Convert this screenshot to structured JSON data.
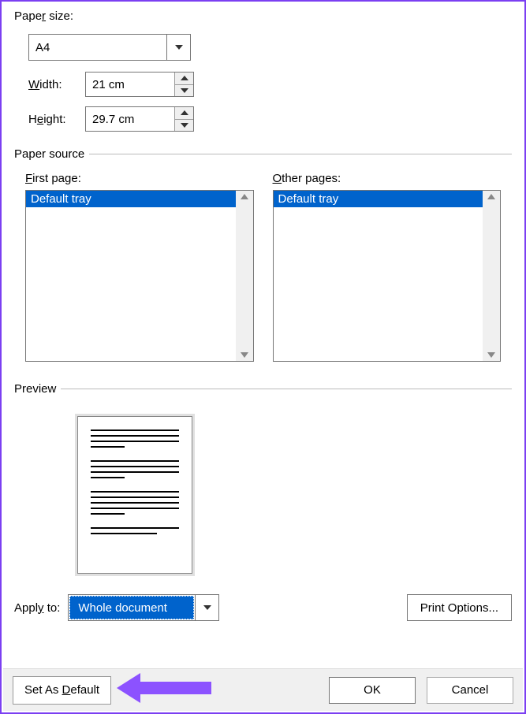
{
  "paper_size": {
    "label_pre": "Pape",
    "label_u": "r",
    "label_post": " size:",
    "selected": "A4",
    "width_label_u": "W",
    "width_label_post": "idth:",
    "width_value": "21 cm",
    "height_label_pre": "H",
    "height_label_u": "e",
    "height_label_post": "ight:",
    "height_value": "29.7 cm"
  },
  "paper_source": {
    "legend": "Paper source",
    "first_page_label_u": "F",
    "first_page_label_post": "irst page:",
    "first_page_selected": "Default tray",
    "other_pages_label_u": "O",
    "other_pages_label_post": "ther pages:",
    "other_pages_selected": "Default tray"
  },
  "preview": {
    "legend": "Preview"
  },
  "apply_to": {
    "label_pre": "Appl",
    "label_u": "y",
    "label_post": " to:",
    "selected": "Whole document"
  },
  "buttons": {
    "print_options": "Print Options...",
    "set_default_pre": "Set As ",
    "set_default_u": "D",
    "set_default_post": "efault",
    "ok": "OK",
    "cancel": "Cancel"
  }
}
